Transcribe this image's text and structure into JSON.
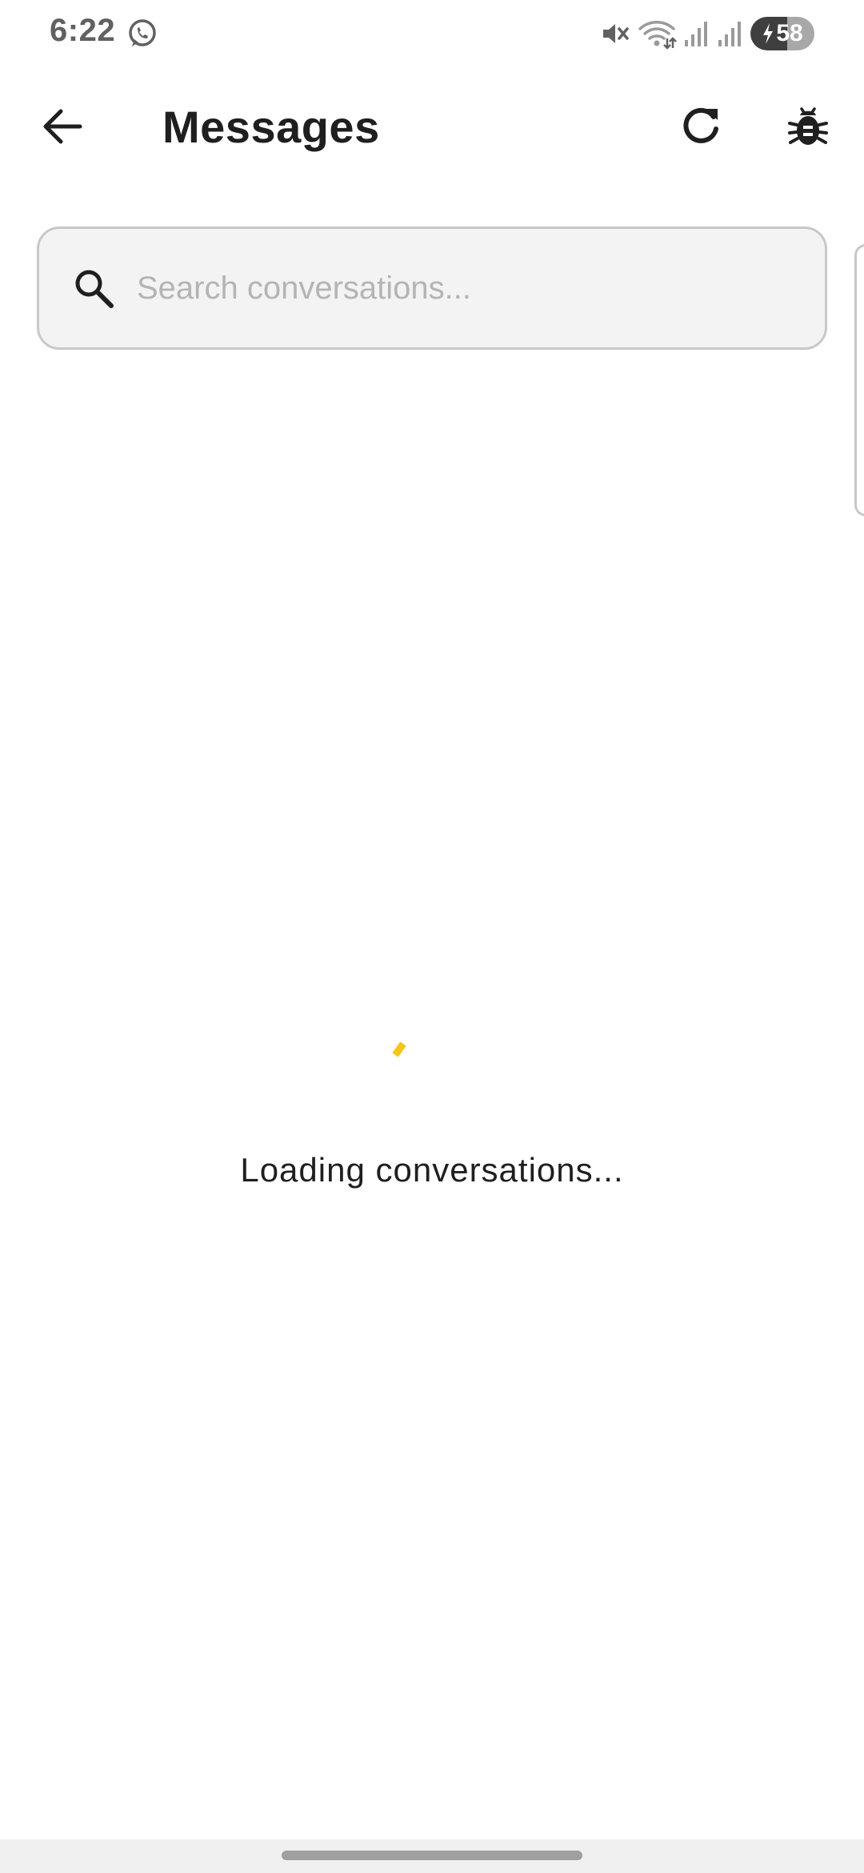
{
  "status_bar": {
    "time": "6:22",
    "battery_level": "58",
    "battery_fraction": 0.58,
    "icons": [
      "whatsapp-icon",
      "mute-icon",
      "wifi-icon",
      "signal-icon",
      "signal-icon",
      "charging-icon"
    ]
  },
  "app_bar": {
    "title": "Messages",
    "back_icon": "arrow-left-icon",
    "refresh_icon": "refresh-icon",
    "debug_icon": "bug-icon"
  },
  "search": {
    "placeholder": "Search conversations...",
    "value": "",
    "icon": "search-icon"
  },
  "loading": {
    "text": "Loading conversations...",
    "spinner_color": "#F5C518"
  },
  "colors": {
    "accent": "#F5C518",
    "title": "#1F1F1F",
    "search_bg": "#F3F3F3",
    "search_border": "#C8C8C8",
    "placeholder": "#B4B4B4"
  }
}
